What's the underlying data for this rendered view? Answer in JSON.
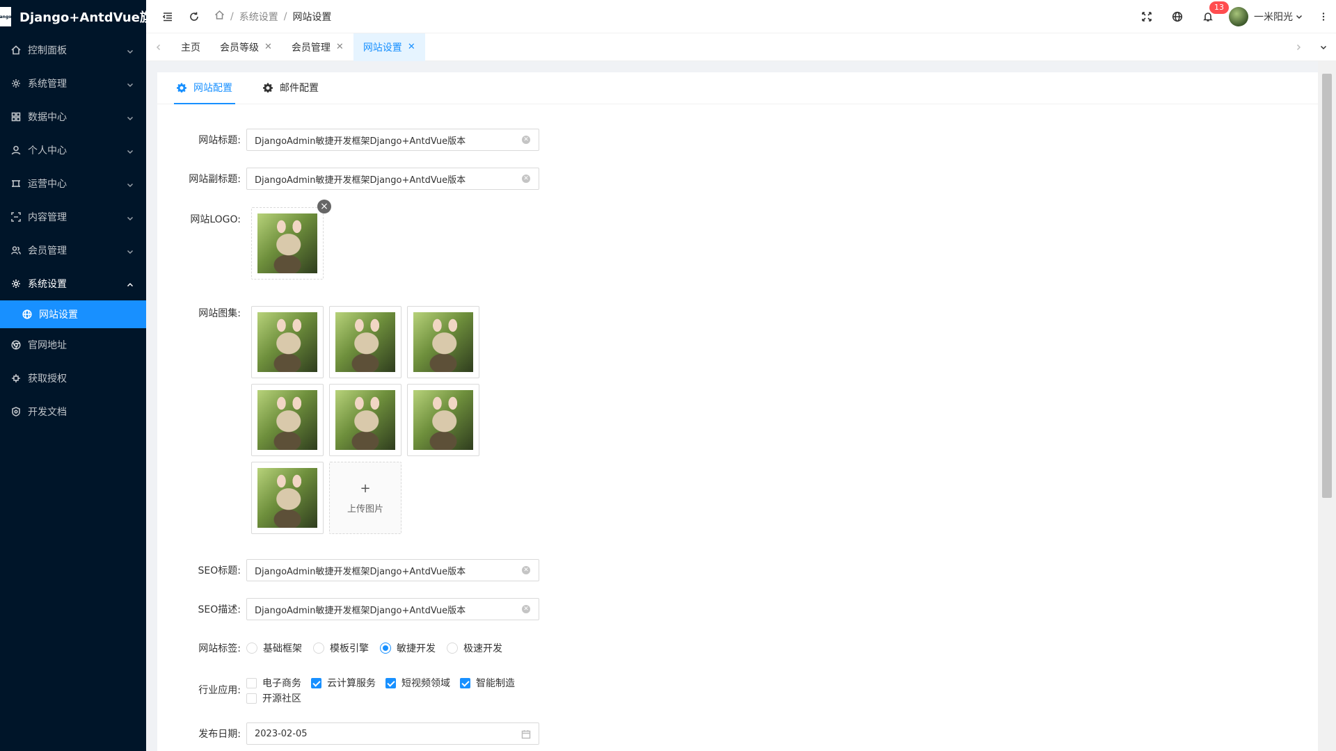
{
  "app": {
    "title": "Django+AntdVue旗舰版",
    "logo_text": "ango"
  },
  "sidebar": {
    "items": [
      {
        "label": "控制面板",
        "icon": "home-icon",
        "arrow": "down"
      },
      {
        "label": "系统管理",
        "icon": "gear-icon",
        "arrow": "down"
      },
      {
        "label": "数据中心",
        "icon": "grid-icon",
        "arrow": "down"
      },
      {
        "label": "个人中心",
        "icon": "user-icon",
        "arrow": "down"
      },
      {
        "label": "运营中心",
        "icon": "frame-icon",
        "arrow": "down"
      },
      {
        "label": "内容管理",
        "icon": "scan-icon",
        "arrow": "down"
      },
      {
        "label": "会员管理",
        "icon": "team-icon",
        "arrow": "down"
      },
      {
        "label": "系统设置",
        "icon": "gear-icon",
        "arrow": "up"
      }
    ],
    "active_sub": {
      "label": "网站设置",
      "icon": "globe-icon"
    },
    "bottom_items": [
      {
        "label": "官网地址",
        "icon": "chrome-icon"
      },
      {
        "label": "获取授权",
        "icon": "plug-icon"
      },
      {
        "label": "开发文档",
        "icon": "doc-icon"
      }
    ]
  },
  "header": {
    "breadcrumb": [
      "系统设置",
      "网站设置"
    ],
    "notification_count": "13",
    "user_name": "一米阳光"
  },
  "tabs": [
    {
      "label": "主页",
      "closable": false,
      "active": false
    },
    {
      "label": "会员等级",
      "closable": true,
      "active": false
    },
    {
      "label": "会员管理",
      "closable": true,
      "active": false
    },
    {
      "label": "网站设置",
      "closable": true,
      "active": true
    }
  ],
  "subtabs": [
    {
      "label": "网站配置",
      "active": true
    },
    {
      "label": "邮件配置",
      "active": false
    }
  ],
  "form": {
    "site_title": {
      "label": "网站标题:",
      "value": "DjangoAdmin敏捷开发框架Django+AntdVue版本"
    },
    "site_subtitle": {
      "label": "网站副标题:",
      "value": "DjangoAdmin敏捷开发框架Django+AntdVue版本"
    },
    "site_logo": {
      "label": "网站LOGO:"
    },
    "site_gallery": {
      "label": "网站图集:",
      "image_count": 7,
      "upload_label": "上传图片",
      "upload_plus": "+"
    },
    "seo_title": {
      "label": "SEO标题:",
      "value": "DjangoAdmin敏捷开发框架Django+AntdVue版本"
    },
    "seo_desc": {
      "label": "SEO描述:",
      "value": "DjangoAdmin敏捷开发框架Django+AntdVue版本"
    },
    "site_tags": {
      "label": "网站标签:",
      "options": [
        "基础框架",
        "模板引擎",
        "敏捷开发",
        "极速开发"
      ],
      "selected": "敏捷开发"
    },
    "industry": {
      "label": "行业应用:",
      "options": [
        {
          "label": "电子商务",
          "checked": false
        },
        {
          "label": "云计算服务",
          "checked": true
        },
        {
          "label": "短视频领域",
          "checked": true
        },
        {
          "label": "智能制造",
          "checked": true
        },
        {
          "label": "开源社区",
          "checked": false
        }
      ]
    },
    "publish_date": {
      "label": "发布日期:",
      "value": "2023-02-05"
    }
  },
  "colors": {
    "sidebar_bg": "#001529",
    "accent": "#1890ff"
  }
}
